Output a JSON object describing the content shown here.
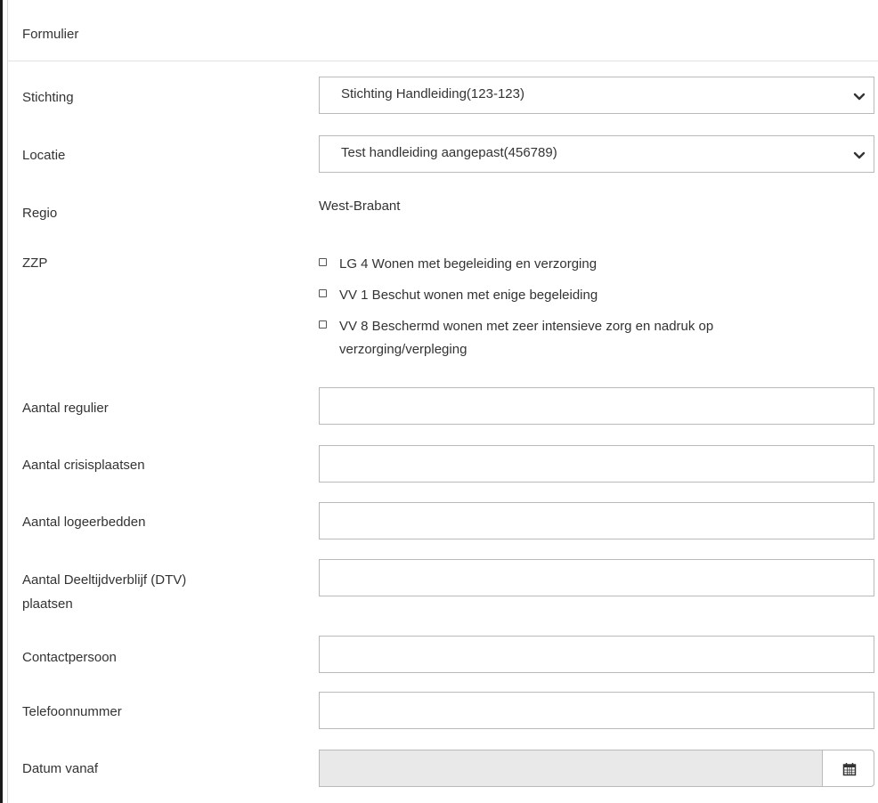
{
  "header": {
    "title": "Formulier"
  },
  "form": {
    "stichting": {
      "label": "Stichting",
      "value": "Stichting Handleiding(123-123)"
    },
    "locatie": {
      "label": "Locatie",
      "value": "Test handleiding aangepast(456789)"
    },
    "regio": {
      "label": "Regio",
      "value": "West-Brabant"
    },
    "zzp": {
      "label": "ZZP",
      "options": [
        {
          "label": "LG 4 Wonen met begeleiding en verzorging",
          "checked": false
        },
        {
          "label": "VV 1 Beschut wonen met enige begeleiding",
          "checked": false
        },
        {
          "label_line1": "VV 8 Beschermd wonen met zeer intensieve zorg en nadruk op",
          "label_line2": "verzorging/verpleging",
          "checked": false
        }
      ]
    },
    "aantal_regulier": {
      "label": "Aantal regulier",
      "value": ""
    },
    "aantal_crisis": {
      "label": "Aantal crisisplaatsen",
      "value": ""
    },
    "aantal_logeer": {
      "label": "Aantal logeerbedden",
      "value": ""
    },
    "aantal_dtv": {
      "label_line1": "Aantal Deeltijdverblijf (DTV)",
      "label_line2": "plaatsen",
      "value": ""
    },
    "contactpersoon": {
      "label": "Contactpersoon",
      "value": ""
    },
    "telefoon": {
      "label": "Telefoonnummer",
      "value": ""
    },
    "datum_vanaf": {
      "label": "Datum vanaf",
      "value": ""
    }
  },
  "icons": {
    "select_chevron": "chevron-down-icon",
    "date_picker": "calendar-icon"
  }
}
